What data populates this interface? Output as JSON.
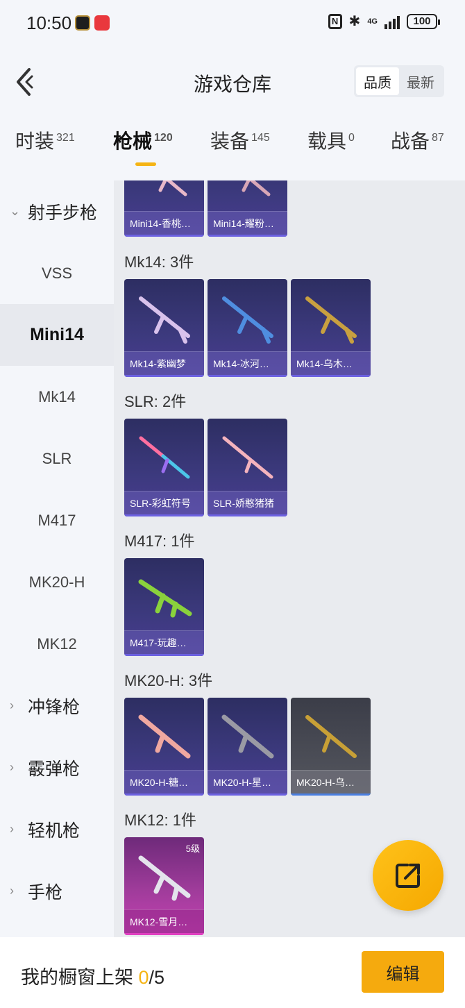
{
  "status_bar": {
    "time": "10:50",
    "network": "4G",
    "battery": "100"
  },
  "header": {
    "title": "游戏仓库",
    "sort_quality": "品质",
    "sort_latest": "最新"
  },
  "tabs": [
    {
      "label": "时装",
      "count": "321"
    },
    {
      "label": "枪械",
      "count": "120"
    },
    {
      "label": "装备",
      "count": "145"
    },
    {
      "label": "载具",
      "count": "0"
    },
    {
      "label": "战备",
      "count": "87"
    }
  ],
  "sidebar": {
    "group_sniper": "射手步枪",
    "items": [
      "VSS",
      "Mini14",
      "Mk14",
      "SLR",
      "M417",
      "MK20-H",
      "MK12"
    ],
    "group_smg": "冲锋枪",
    "group_shotgun": "霰弹枪",
    "group_lmg": "轻机枪",
    "group_pistol": "手枪"
  },
  "sections": {
    "mini14": {
      "items": [
        "Mini14-香桃…",
        "Mini14-耀粉…"
      ]
    },
    "mk14": {
      "title": "Mk14: 3件",
      "items": [
        "Mk14-紫幽梦",
        "Mk14-冰河…",
        "Mk14-乌木…"
      ]
    },
    "slr": {
      "title": "SLR: 2件",
      "items": [
        "SLR-彩虹符号",
        "SLR-娇憨猪猪"
      ]
    },
    "m417": {
      "title": "M417: 1件",
      "items": [
        "M417-玩趣…"
      ]
    },
    "mk20h": {
      "title": "MK20-H: 3件",
      "items": [
        "MK20-H-糖…",
        "MK20-H-星…",
        "MK20-H-乌…"
      ]
    },
    "mk12": {
      "title": "MK12: 1件",
      "items": [
        "MK12-雪月…"
      ],
      "level": "5级"
    }
  },
  "bottom_bar": {
    "label": "我的橱窗上架",
    "current": "0",
    "total": "/5",
    "edit_button": "编辑"
  },
  "colors": {
    "accent": "#f5aa0e",
    "card_purple": "#3d3a7f",
    "card_pink": "#c642b3"
  }
}
